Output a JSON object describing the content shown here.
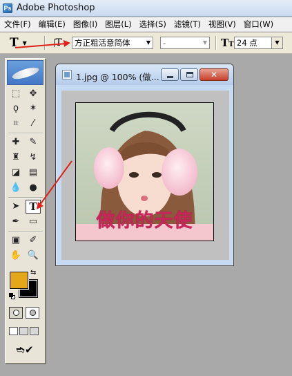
{
  "window": {
    "title": "Adobe Photoshop",
    "icon": "photoshop-icon"
  },
  "menu": [
    {
      "label": "文件(F)"
    },
    {
      "label": "编辑(E)"
    },
    {
      "label": "图像(I)"
    },
    {
      "label": "图层(L)"
    },
    {
      "label": "选择(S)"
    },
    {
      "label": "滤镜(T)"
    },
    {
      "label": "视图(V)"
    },
    {
      "label": "窗口(W)"
    }
  ],
  "options_bar": {
    "tool_preset_icon": "type-tool-icon",
    "orientation_icon": "text-orientation-icon",
    "font_family": "方正粗活意简体",
    "font_style": "-",
    "font_size_icon": "font-size-icon",
    "font_size": "24 点"
  },
  "toolbox": {
    "active_tool": "type-tool",
    "foreground_color": "#e4a61a",
    "background_color": "#000000"
  },
  "document": {
    "title": "1.jpg @ 100% (做...",
    "caption": "做你的天使",
    "caption_color": "#c8255a"
  },
  "annotations": {
    "arrow_color": "#e0201a"
  }
}
